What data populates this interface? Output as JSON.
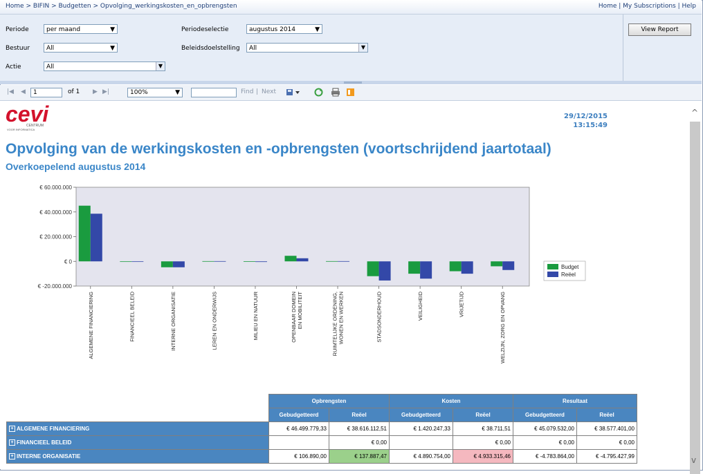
{
  "breadcrumb": "Home > BIFIN > Budgetten > Opvolging_werkingskosten_en_opbrengsten",
  "top_links": "Home | My Subscriptions | Help",
  "params": {
    "periode_label": "Periode",
    "periode_value": "per maand",
    "periodeselectie_label": "Periodeselectie",
    "periodeselectie_value": "augustus 2014",
    "bestuur_label": "Bestuur",
    "bestuur_value": "All",
    "beleidsdoel_label": "Beleidsdoelstelling",
    "beleidsdoel_value": "All",
    "actie_label": "Actie",
    "actie_value": "All",
    "view_report": "View Report"
  },
  "toolbar": {
    "page": "1",
    "of_pages": "of 1",
    "zoom": "100%",
    "find": "Find",
    "sep": "|",
    "next": "Next"
  },
  "report": {
    "date": "29/12/2015",
    "time": "13:15:49",
    "title": "Opvolging van de werkingskosten en -opbrengsten (voortschrijdend jaartotaal)",
    "subtitle": "Overkoepelend augustus 2014",
    "logo_text": "cevi",
    "logo_sub1": "CENTRUM",
    "logo_sub2": "VOOR INFORMATICA"
  },
  "chart_data": {
    "type": "bar",
    "categories": [
      [
        "ALGEMENE FINANCIERING"
      ],
      [
        "FINANCIEEL BELEID"
      ],
      [
        "INTERNE ORGANISATIE"
      ],
      [
        "LEREN EN ONDERWIJS"
      ],
      [
        "MILIEU EN NATUUR"
      ],
      [
        "OPENBAAR DOMEIN",
        "EN MOBILITEIT"
      ],
      [
        "RUIMTELIJKE ORDENING,",
        "WONEN EN WERKEN"
      ],
      [
        "STADSONDERHOUD"
      ],
      [
        "VEILIGHEID"
      ],
      [
        "VRIJETIJD"
      ],
      [
        "WELZIJN, ZORG EN OPVANG"
      ]
    ],
    "series": [
      {
        "name": "Budget",
        "color": "#1a9b3f",
        "values": [
          45079532,
          0,
          -4783864,
          200000,
          100000,
          4500000,
          200000,
          -12000000,
          -10000000,
          -8000000,
          -4000000
        ]
      },
      {
        "name": "Reëel",
        "color": "#3348a8",
        "values": [
          38577401,
          0,
          -4795428,
          200000,
          -500000,
          2500000,
          200000,
          -15500000,
          -14000000,
          -10000000,
          -7000000
        ]
      }
    ],
    "y_ticks": [
      "€ 60.000.000",
      "€ 40.000.000",
      "€ 20.000.000",
      "€ 0",
      "€ -20.000.000"
    ],
    "ylim": [
      -20000000,
      60000000
    ],
    "legend_position": "right"
  },
  "table": {
    "group_headers": [
      "Opbrengsten",
      "Kosten",
      "Resultaat"
    ],
    "sub_headers": [
      "Gebudgetteerd",
      "Reëel",
      "Gebudgetteerd",
      "Reëel",
      "Gebudgetteerd",
      "Reëel"
    ],
    "expand_symbol": "+",
    "rows": [
      {
        "label": "ALGEMENE FINANCIERING",
        "cells": [
          "€ 46.499.779,33",
          "€ 38.616.112,51",
          "€ 1.420.247,33",
          "€ 38.711,51",
          "€ 45.079.532,00",
          "€ 38.577.401,00"
        ]
      },
      {
        "label": "FINANCIEEL BELEID",
        "cells": [
          "",
          "€ 0,00",
          "",
          "€ 0,00",
          "€ 0,00",
          "€ 0,00"
        ]
      },
      {
        "label": "INTERNE ORGANISATIE",
        "cells": [
          "€ 106.890,00",
          "€ 137.887,47",
          "€ 4.890.754,00",
          "€ 4.933.315,46",
          "€ -4.783.864,00",
          "€ -4.795.427,99"
        ]
      }
    ]
  }
}
